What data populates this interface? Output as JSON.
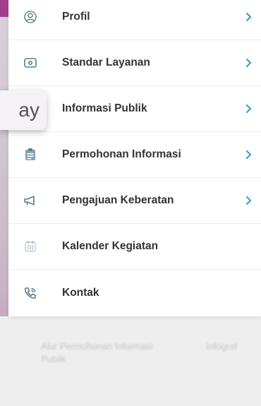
{
  "menu": {
    "items": [
      {
        "label": "Profil",
        "icon": "user-icon",
        "chevron": true
      },
      {
        "label": "Standar Layanan",
        "icon": "card-icon",
        "chevron": true
      },
      {
        "label": "Informasi Publik",
        "icon": "info-icon",
        "chevron": true
      },
      {
        "label": "Permohonan Informasi",
        "icon": "form-icon",
        "chevron": true
      },
      {
        "label": "Pengajuan Keberatan",
        "icon": "megaphone-icon",
        "chevron": true
      },
      {
        "label": "Kalender Kegiatan",
        "icon": "calendar-icon",
        "chevron": false
      },
      {
        "label": "Kontak",
        "icon": "phone-icon",
        "chevron": false
      }
    ]
  },
  "tooltip": {
    "text": "ay"
  },
  "background": {
    "ghost_left": "Alur Permohonan Informasi Publik",
    "ghost_right": "Infograf"
  },
  "colors": {
    "accent": "#3ea0c4",
    "icon": "#5a7f8e",
    "label": "#333333",
    "header": "#a23c8f"
  }
}
